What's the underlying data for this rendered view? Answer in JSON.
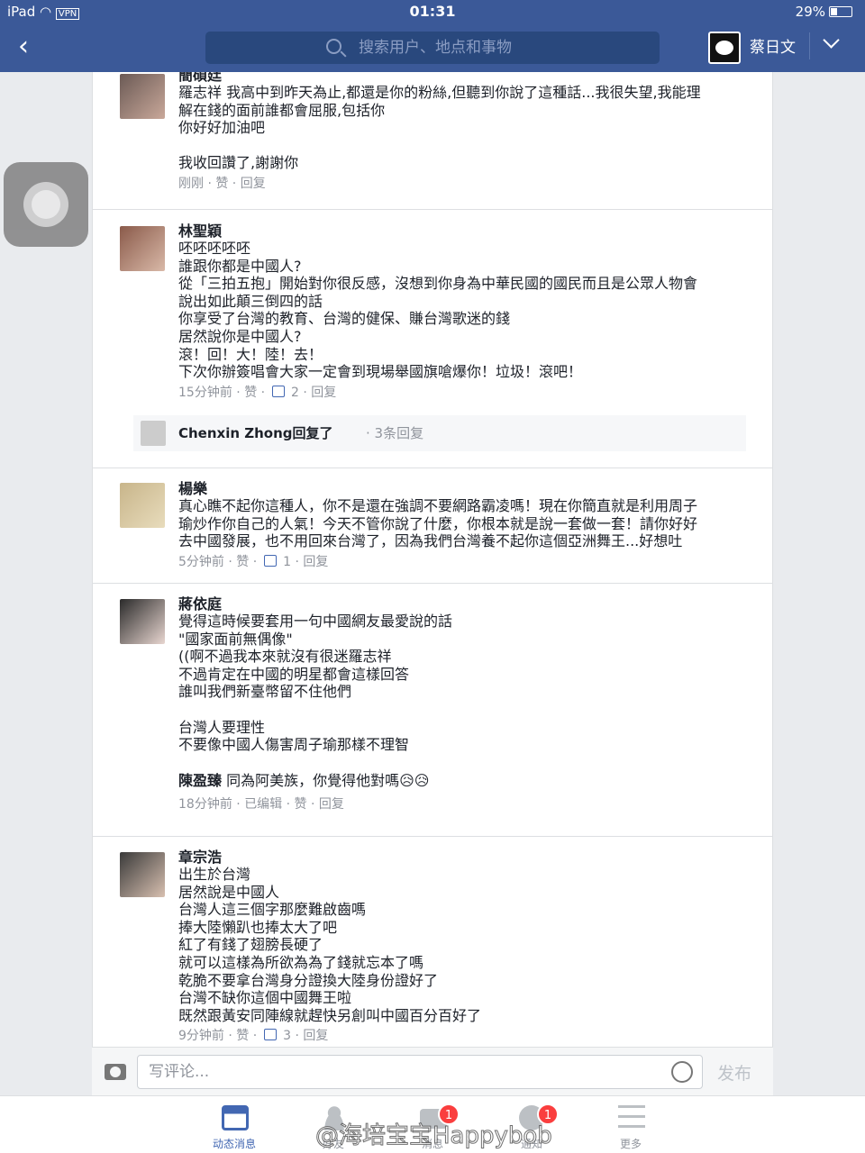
{
  "status_bar": {
    "device": "iPad",
    "network": "VPN",
    "time": "01:31",
    "battery": "29%"
  },
  "nav": {
    "search_placeholder": "搜索用户、地点和事物",
    "user_name": "蔡日文"
  },
  "comments": [
    {
      "name": "簡碩廷",
      "text": "羅志祥 我高中到昨天為止,都還是你的粉絲,但聽到你說了這種話...我很失望,我能理\n解在錢的面前誰都會屈服,包括你\n你好好加油吧\n\n我收回讚了,謝謝你",
      "time": "刚刚",
      "like": "赞",
      "reply": "回复",
      "edited": "",
      "likes": ""
    },
    {
      "name": "林聖穎",
      "text": "呸呸呸呸呸\n誰跟你都是中國人?\n從「三拍五抱」開始對你很反感，沒想到你身為中華民國的國民而且是公眾人物會\n說出如此顛三倒四的話\n你享受了台灣的教育、台灣的健保、賺台灣歌迷的錢\n居然說你是中國人?\n滾！回！大！陸！去！\n下次你辦簽唱會大家一定會到現場舉國旗嗆爆你！垃圾！滾吧！",
      "time": "15分钟前",
      "like": "赞",
      "reply": "回复",
      "edited": "",
      "likes": "2"
    },
    {
      "name": "楊樂",
      "text": "真心瞧不起你這種人，你不是還在強調不要網路霸凌嗎！現在你簡直就是利用周子\n瑜炒作你自己的人氣！今天不管你說了什麼，你根本就是說一套做一套！請你好好\n去中國發展，也不用回來台灣了，因為我們台灣養不起你這個亞洲舞王...好想吐",
      "time": "5分钟前",
      "like": "赞",
      "reply": "回复",
      "edited": "",
      "likes": "1"
    },
    {
      "name": "蔣依庭",
      "text": "覺得這時候要套用一句中國網友最愛說的話\n\"國家面前無偶像\"\n((啊不過我本來就沒有很迷羅志祥\n不過肯定在中國的明星都會這樣回答\n誰叫我們新臺幣留不住他們\n\n台灣人要理性\n不要像中國人傷害周子瑜那樣不理智",
      "mention": "陳盈臻",
      "mention_text": " 同為阿美族，你覺得他對嗎😥😥",
      "time": "18分钟前",
      "like": "赞",
      "reply": "回复",
      "edited": "已编辑",
      "likes": ""
    },
    {
      "name": "章宗浩",
      "text": "出生於台灣\n居然說是中國人\n台灣人這三個字那麼難啟齒嗎\n捧大陸懶趴也捧太大了吧\n紅了有錢了翅膀長硬了\n就可以這樣為所欲為為了錢就忘本了嗎\n乾脆不要拿台灣身分證換大陸身份證好了\n台灣不缺你這個中國舞王啦\n既然跟黃安同陣線就趕快另創叫中國百分百好了",
      "time": "9分钟前",
      "like": "赞",
      "reply": "回复",
      "edited": "",
      "likes": "3"
    }
  ],
  "reply_preview": {
    "name": "Chenxin Zhong回复了",
    "count": "3条回复"
  },
  "comment_bar": {
    "placeholder": "写评论...",
    "publish": "发布"
  },
  "tabs": [
    {
      "label": "动态消息",
      "badge": ""
    },
    {
      "label": "好友",
      "badge": ""
    },
    {
      "label": "消息",
      "badge": "1"
    },
    {
      "label": "通知",
      "badge": "1"
    },
    {
      "label": "更多",
      "badge": ""
    }
  ],
  "watermark": "@海培宝宝Happybob",
  "colors": {
    "brand": "#3b5998",
    "meta": "#90949c",
    "badge": "#fa3e3e"
  }
}
